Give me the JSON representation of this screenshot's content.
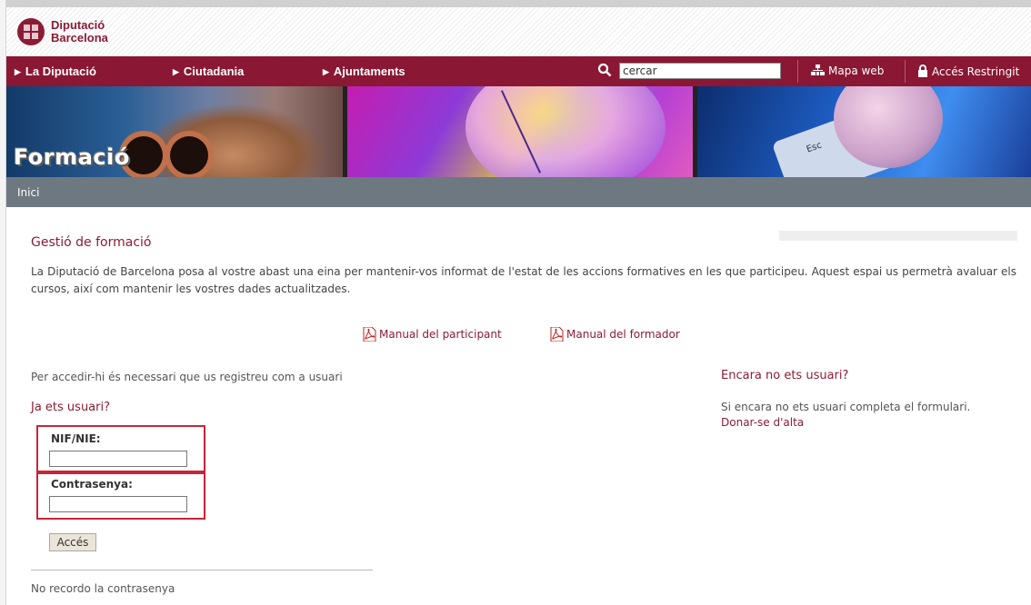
{
  "header": {
    "logo_line1": "Diputació",
    "logo_line2": "Barcelona"
  },
  "nav": {
    "items": [
      "La Diputació",
      "Ciutadania",
      "Ajuntaments"
    ],
    "search_value": "cercar",
    "map_label": "Mapa web",
    "restricted_label": "Accés Restringit"
  },
  "banner": {
    "title": "Formació",
    "key_label": "Esc"
  },
  "breadcrumb": {
    "home": "Inici"
  },
  "main": {
    "title": "Gestió de formació",
    "intro": "La Diputació de Barcelona posa al vostre abast una eina per mantenir-vos informat de l'estat de les accions formatives en les que participeu. Aquest espai us permetrà avaluar els cursos, així com mantenir les vostres dades actualitzades.",
    "manual_participant": "Manual del participant",
    "manual_trainer": "Manual del formador",
    "access_text": "Per accedir-hi és necessari que us registreu com a usuari"
  },
  "login": {
    "heading": "Ja ets usuari?",
    "nif_label": "NIF/NIE:",
    "nif_value": "",
    "password_label": "Contrasenya:",
    "password_value": "",
    "submit_label": "Accés",
    "forgot_label": "No recordo la contrasenya"
  },
  "signup": {
    "heading": "Encara no ets usuari?",
    "text": "Si encara no ets usuari completa el formulari.",
    "link": "Donar-se d'alta"
  },
  "colors": {
    "brand": "#8a1733",
    "crumb_bar": "#6e7880",
    "highlight": "#c8243a"
  },
  "icons": [
    "search-icon",
    "sitemap-icon",
    "lock-icon",
    "pdf-icon"
  ]
}
